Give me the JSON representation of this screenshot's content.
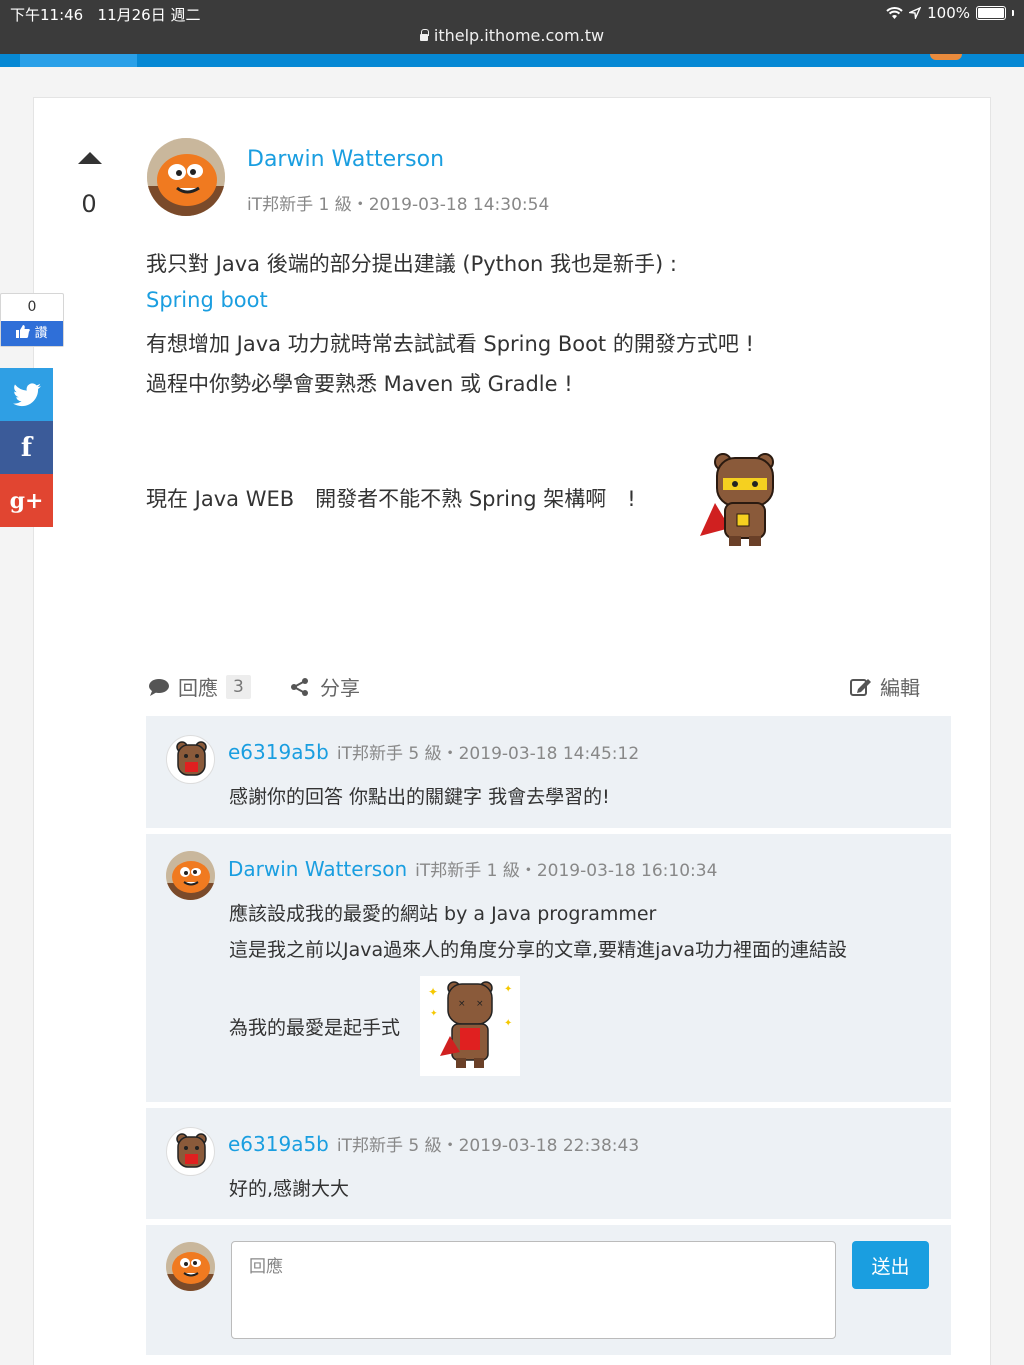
{
  "status_bar": {
    "time": "下午11:46",
    "date": "11月26日 週二",
    "battery": "100%",
    "url": "ithelp.ithome.com.tw"
  },
  "social": {
    "like_count": "0",
    "like_label": "讚",
    "twitter_icon": "twitter-icon",
    "facebook_icon": "facebook-icon",
    "googleplus_icon": "googleplus-icon"
  },
  "post": {
    "vote_count": "0",
    "author": "Darwin Watterson",
    "meta": "iT邦新手 1 級・2019-03-18 14:30:54",
    "lines": [
      "我只對 Java 後端的部分提出建議 (Python 我也是新手) :",
      "Spring boot",
      "有想增加 Java 功力就時常去試試看 Spring Boot 的開發方式吧 !",
      "過程中你勢必學會要熟悉 Maven 或 Gradle !",
      "現在 Java WEB　開發者不能不熟 Spring 架構啊　!"
    ]
  },
  "actions": {
    "reply_label": "回應",
    "reply_count": "3",
    "share_label": "分享",
    "edit_label": "編輯"
  },
  "comments": [
    {
      "author": "e6319a5b",
      "meta": "iT邦新手 5 級・2019-03-18 14:45:12",
      "text": "感謝你的回答 你點出的關鍵字 我會去學習的!"
    },
    {
      "author": "Darwin Watterson",
      "meta": "iT邦新手 1 級・2019-03-18 16:10:34",
      "link": "應該設成我的最愛的網站 by a Java programmer",
      "text": "這是我之前以Java過來人的角度分享的文章,要精進java功力裡面的連結設",
      "text2": "為我的最愛是起手式"
    },
    {
      "author": "e6319a5b",
      "meta": "iT邦新手 5 級・2019-03-18 22:38:43",
      "text": "好的,感謝大大"
    }
  ],
  "reply_form": {
    "placeholder": "回應",
    "submit_label": "送出"
  }
}
